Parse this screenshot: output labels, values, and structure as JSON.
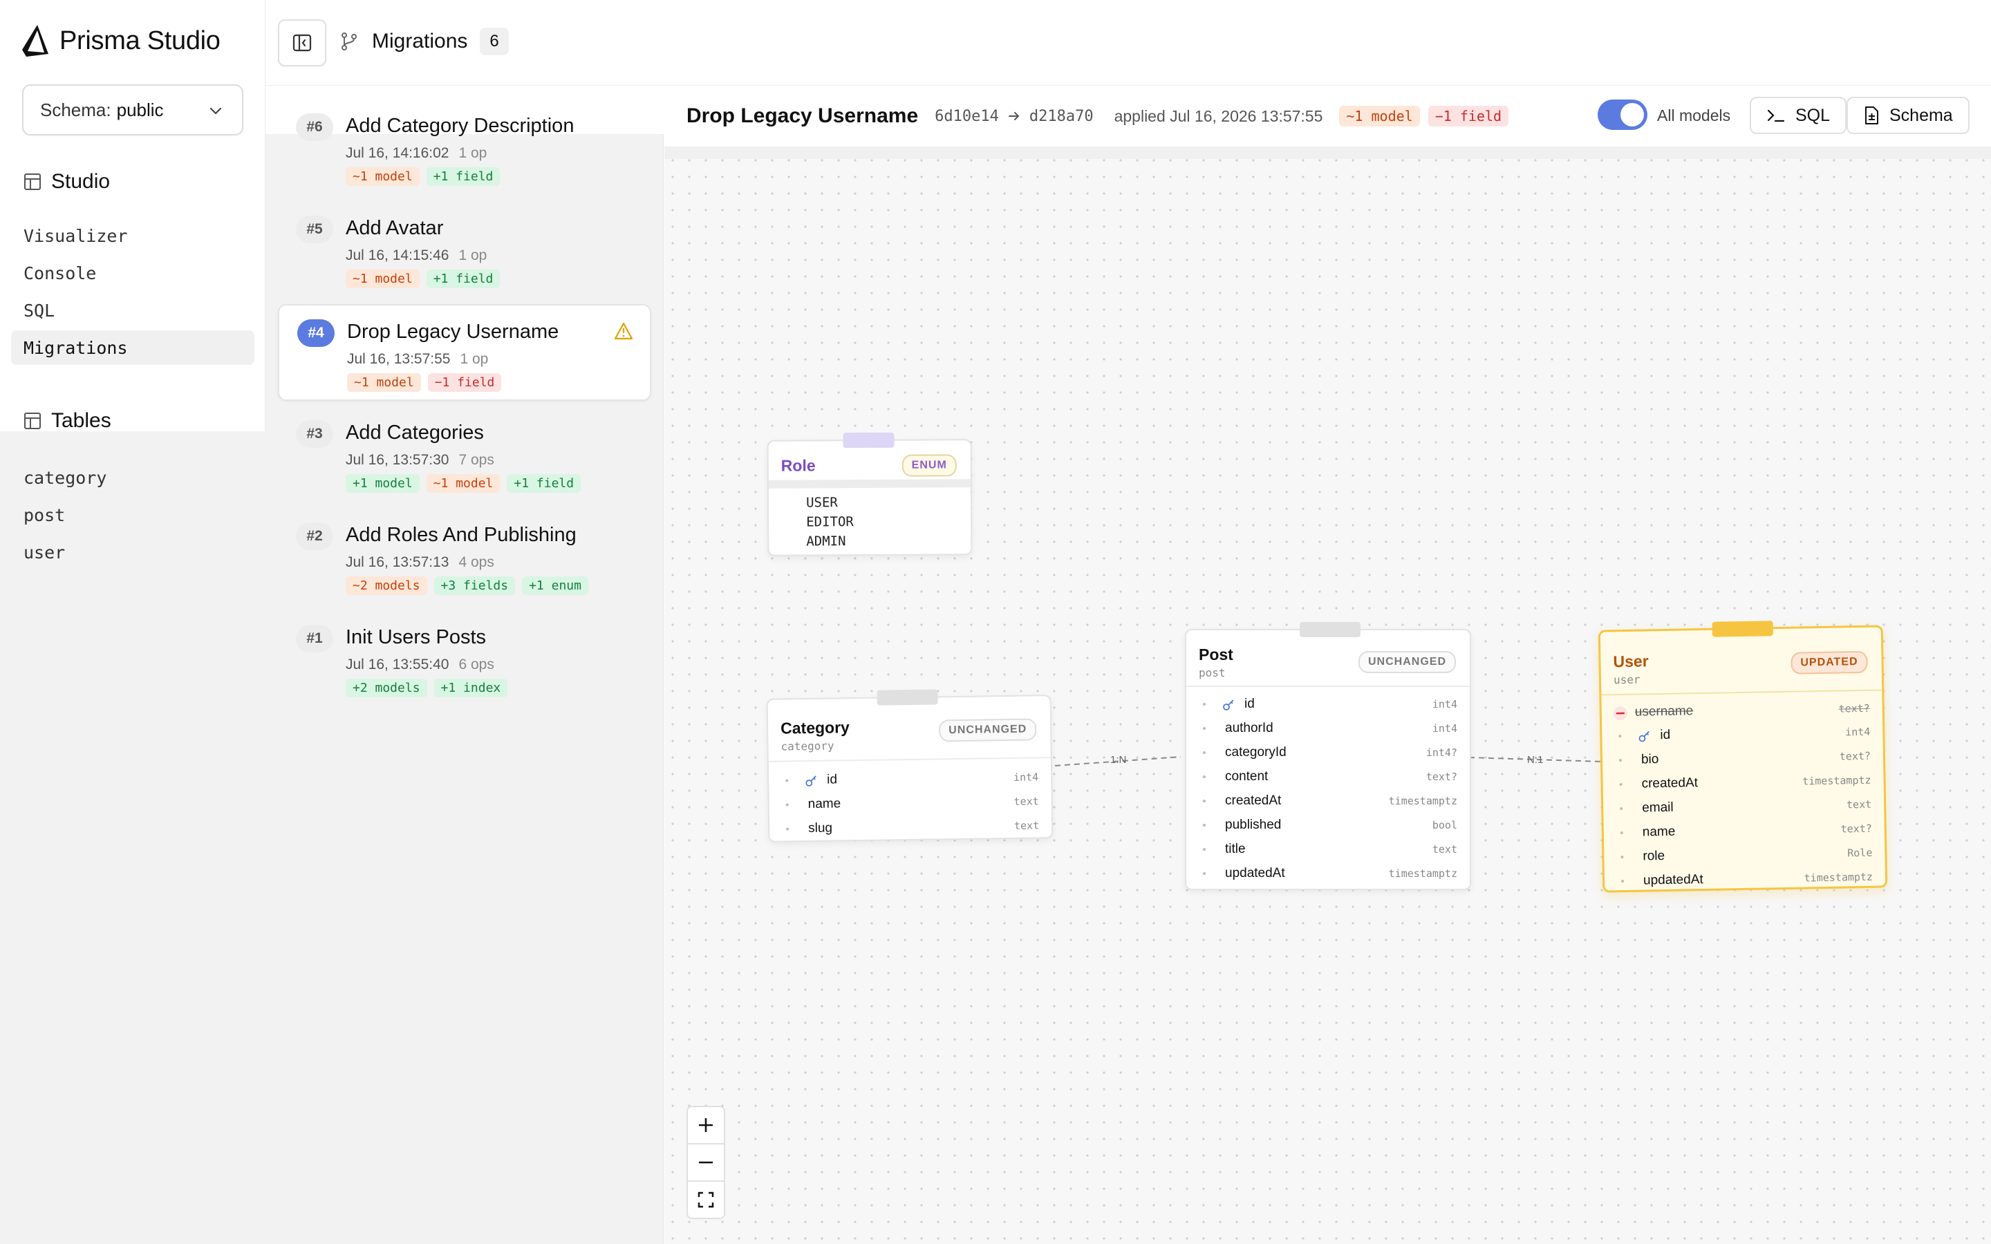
{
  "app": {
    "name": "Prisma Studio"
  },
  "sidebar": {
    "schema_label": "Schema:",
    "schema_value": "public",
    "studio_heading": "Studio",
    "studio_items": [
      "Visualizer",
      "Console",
      "SQL",
      "Migrations"
    ],
    "active_item": "Migrations",
    "tables_heading": "Tables",
    "tables": [
      "category",
      "post",
      "user"
    ]
  },
  "topbar": {
    "title": "Migrations",
    "count": "6"
  },
  "migrations": [
    {
      "num": "#6",
      "title": "Add Category Description",
      "time": "Jul 16, 14:16:02",
      "ops": "1 op",
      "tags": [
        {
          "text": "~1 model",
          "color": "orange"
        },
        {
          "text": "+1 field",
          "color": "green"
        }
      ]
    },
    {
      "num": "#5",
      "title": "Add Avatar",
      "time": "Jul 16, 14:15:46",
      "ops": "1 op",
      "tags": [
        {
          "text": "~1 model",
          "color": "orange"
        },
        {
          "text": "+1 field",
          "color": "green"
        }
      ]
    },
    {
      "num": "#4",
      "title": "Drop Legacy Username",
      "time": "Jul 16, 13:57:55",
      "ops": "1 op",
      "selected": true,
      "warning": true,
      "tags": [
        {
          "text": "~1 model",
          "color": "orange"
        },
        {
          "text": "−1 field",
          "color": "red"
        }
      ]
    },
    {
      "num": "#3",
      "title": "Add Categories",
      "time": "Jul 16, 13:57:30",
      "ops": "7 ops",
      "tags": [
        {
          "text": "+1 model",
          "color": "green"
        },
        {
          "text": "~1 model",
          "color": "orange"
        },
        {
          "text": "+1 field",
          "color": "green"
        }
      ]
    },
    {
      "num": "#2",
      "title": "Add Roles And Publishing",
      "time": "Jul 16, 13:57:13",
      "ops": "4 ops",
      "tags": [
        {
          "text": "~2 models",
          "color": "orange"
        },
        {
          "text": "+3 fields",
          "color": "green"
        },
        {
          "text": "+1 enum",
          "color": "green"
        }
      ]
    },
    {
      "num": "#1",
      "title": "Init Users Posts",
      "time": "Jul 16, 13:55:40",
      "ops": "6 ops",
      "tags": [
        {
          "text": "+2 models",
          "color": "green"
        },
        {
          "text": "+1 index",
          "color": "green"
        }
      ]
    }
  ],
  "detail": {
    "title": "Drop Legacy Username",
    "from_hash": "6d10e14",
    "to_hash": "d218a70",
    "applied": "applied Jul 16, 2026 13:57:55",
    "tags": [
      {
        "text": "~1 model",
        "color": "orange"
      },
      {
        "text": "−1 field",
        "color": "red"
      }
    ],
    "toggle_label": "All models",
    "toggle_on": true,
    "sql_button": "SQL",
    "schema_button": "Schema"
  },
  "diagram": {
    "role": {
      "name": "Role",
      "badge": "ENUM",
      "values": [
        "USER",
        "EDITOR",
        "ADMIN"
      ]
    },
    "category": {
      "name": "Category",
      "table": "category",
      "badge": "UNCHANGED",
      "fields": [
        {
          "name": "id",
          "type": "int4",
          "key": true
        },
        {
          "name": "name",
          "type": "text"
        },
        {
          "name": "slug",
          "type": "text"
        }
      ]
    },
    "post": {
      "name": "Post",
      "table": "post",
      "badge": "UNCHANGED",
      "fields": [
        {
          "name": "id",
          "type": "int4",
          "key": true
        },
        {
          "name": "authorId",
          "type": "int4"
        },
        {
          "name": "categoryId",
          "type": "int4?"
        },
        {
          "name": "content",
          "type": "text?"
        },
        {
          "name": "createdAt",
          "type": "timestamptz"
        },
        {
          "name": "published",
          "type": "bool"
        },
        {
          "name": "title",
          "type": "text"
        },
        {
          "name": "updatedAt",
          "type": "timestamptz"
        }
      ]
    },
    "user": {
      "name": "User",
      "table": "user",
      "badge": "UPDATED",
      "removed_field": {
        "name": "username",
        "type": "text?"
      },
      "fields": [
        {
          "name": "id",
          "type": "int4",
          "key": true
        },
        {
          "name": "bio",
          "type": "text?"
        },
        {
          "name": "createdAt",
          "type": "timestamptz"
        },
        {
          "name": "email",
          "type": "text"
        },
        {
          "name": "name",
          "type": "text?"
        },
        {
          "name": "role",
          "type": "Role"
        },
        {
          "name": "updatedAt",
          "type": "timestamptz"
        }
      ]
    },
    "relations": [
      {
        "label": "1:N"
      },
      {
        "label": "N:1"
      }
    ]
  },
  "colors": {
    "accent": "#5b7be0",
    "enum": "#7c4dbd",
    "updated": "#f5c542",
    "removed": "#dc2626"
  }
}
